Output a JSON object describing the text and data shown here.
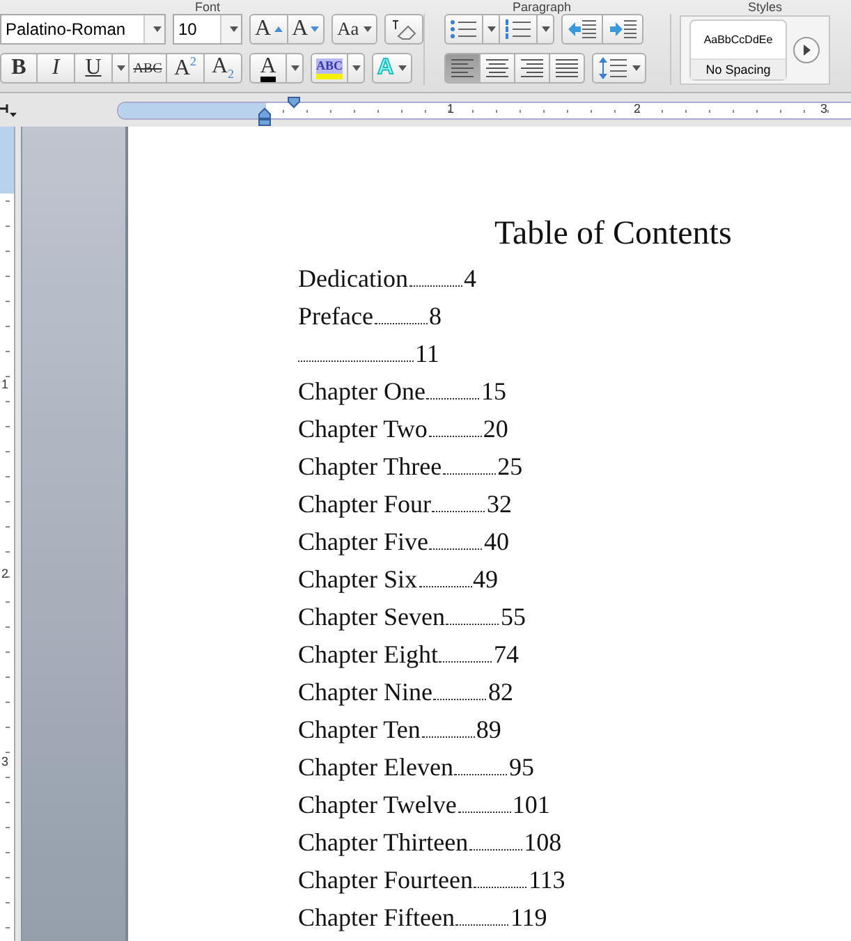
{
  "ribbon": {
    "groups": [
      "Font",
      "Paragraph",
      "Styles"
    ],
    "font": {
      "name": "Palatino-Roman",
      "size": "10",
      "grow_font": "A",
      "shrink_font": "A",
      "change_case": "Aa",
      "bold": "B",
      "italic": "I",
      "underline": "U",
      "strikethrough": "ABC",
      "superscript": "A",
      "subscript": "A",
      "font_color": "A",
      "highlight": "ABC",
      "text_effects": "A",
      "superscript_mark": "2",
      "subscript_mark": "2"
    },
    "paragraph": {
      "alignments": [
        {
          "selected": true
        },
        {
          "selected": false
        },
        {
          "selected": false
        },
        {
          "selected": false
        }
      ]
    },
    "style_card": {
      "sample": "AaBbCcDdEe",
      "name": "No Spacing"
    }
  },
  "ruler": {
    "horizontal_marks": [
      "1",
      "2",
      "3"
    ],
    "vertical_marks": [
      "1",
      "2",
      "3"
    ]
  },
  "document": {
    "title": "Table of Contents",
    "entries": [
      {
        "title": "Dedication",
        "page": "4"
      },
      {
        "title": "Preface",
        "page": "8"
      },
      {
        "page": "11"
      },
      {
        "title": "Chapter One",
        "page": "15"
      },
      {
        "title": "Chapter Two",
        "page": "20"
      },
      {
        "title": "Chapter Three",
        "page": "25"
      },
      {
        "title": "Chapter Four",
        "page": "32"
      },
      {
        "title": "Chapter Five",
        "page": "40"
      },
      {
        "title": "Chapter Six",
        "page": "49"
      },
      {
        "title": "Chapter Seven",
        "page": "55"
      },
      {
        "title": "Chapter Eight",
        "page": "74"
      },
      {
        "title": "Chapter Nine",
        "page": "82"
      },
      {
        "title": "Chapter Ten",
        "page": "89"
      },
      {
        "title": "Chapter Eleven",
        "page": "95"
      },
      {
        "title": "Chapter Twelve",
        "page": "101"
      },
      {
        "title": "Chapter Thirteen",
        "page": "108"
      },
      {
        "title": "Chapter Fourteen",
        "page": "113"
      },
      {
        "title": "Chapter Fifteen",
        "page": "119"
      }
    ]
  }
}
